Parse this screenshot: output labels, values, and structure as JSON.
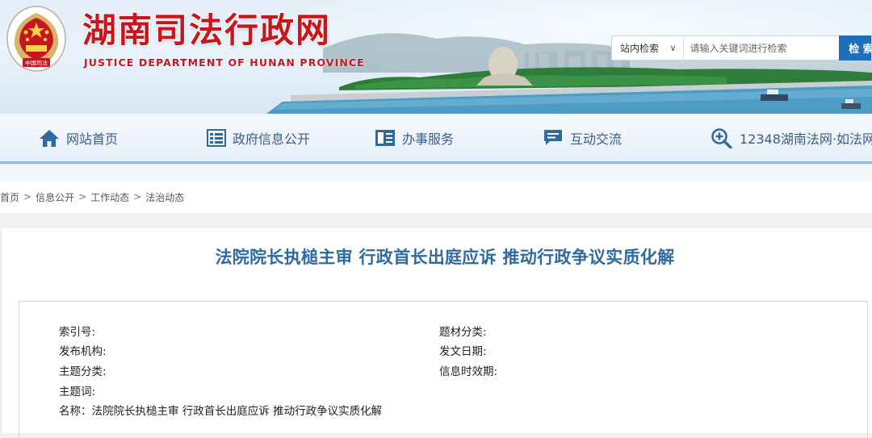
{
  "header": {
    "site_title": "湖南司法行政网",
    "site_subtitle": "JUSTICE DEPARTMENT OF HUNAN PROVINCE",
    "emblem_text": "中国司法",
    "search": {
      "scope_label": "站内检索",
      "placeholder": "请输入关键词进行检索",
      "button_label": "检 索"
    }
  },
  "nav": {
    "items": [
      {
        "label": "网站首页",
        "icon": "home-icon"
      },
      {
        "label": "政府信息公开",
        "icon": "list-icon"
      },
      {
        "label": "办事服务",
        "icon": "book-icon"
      },
      {
        "label": "互动交流",
        "icon": "chat-icon"
      },
      {
        "label": "12348湖南法网·如法网",
        "icon": "zoom-icon"
      }
    ]
  },
  "breadcrumb": [
    "首页",
    "信息公开",
    "工作动态",
    "法治动态"
  ],
  "breadcrumb_separator": ">",
  "article": {
    "title": "法院院长执槌主审 行政首长出庭应诉 推动行政争议实质化解",
    "meta": {
      "index_no": "索引号:",
      "category": "题材分类:",
      "publisher": "发布机构:",
      "publish_date": "发文日期:",
      "topic": "主题分类:",
      "validity": "信息时效期:",
      "keywords": "主题词:",
      "name": "名称：法院院长执槌主审 行政首长出庭应诉 推动行政争议实质化解"
    }
  },
  "colors": {
    "brand_red": "#c8161e",
    "nav_text": "#3a5d85",
    "title_blue": "#2f6a9f",
    "search_button": "#1f6fb8"
  }
}
